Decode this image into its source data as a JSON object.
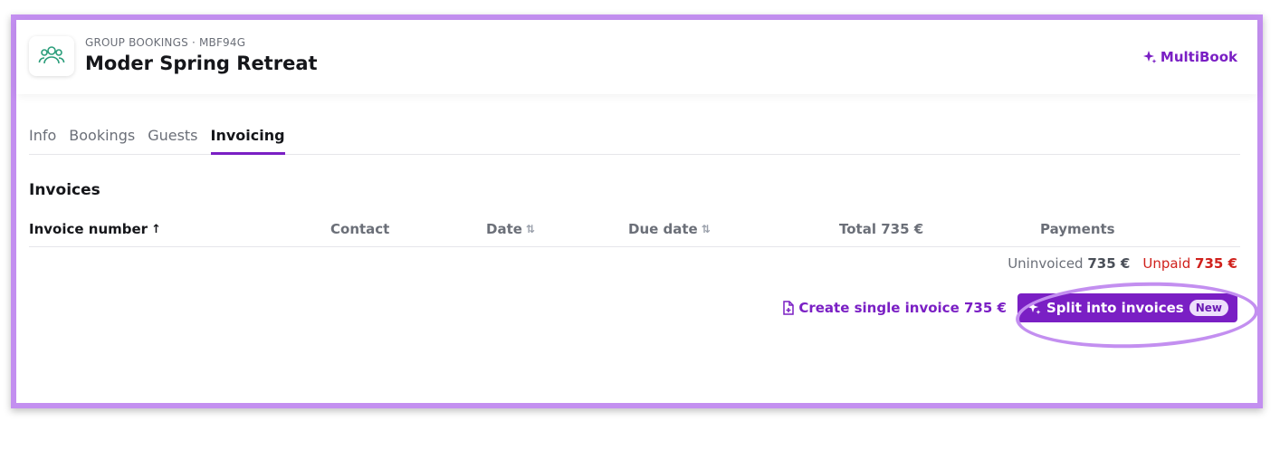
{
  "header": {
    "eyebrow": "GROUP BOOKINGS · MBF94G",
    "title": "Moder Spring Retreat",
    "brand_label": "MultiBook",
    "logo_icon": "group-people-icon",
    "brand_icon": "sparkle-icon"
  },
  "tabs": [
    {
      "label": "Info",
      "active": false
    },
    {
      "label": "Bookings",
      "active": false
    },
    {
      "label": "Guests",
      "active": false
    },
    {
      "label": "Invoicing",
      "active": true
    }
  ],
  "invoices": {
    "section_title": "Invoices",
    "columns": [
      {
        "label": "Invoice number",
        "sort": "asc"
      },
      {
        "label": "Contact",
        "sort": "none"
      },
      {
        "label": "Date",
        "sort": "sortable"
      },
      {
        "label": "Due date",
        "sort": "sortable"
      },
      {
        "label": "Total 735 €",
        "sort": "none"
      },
      {
        "label": "Payments",
        "sort": "none"
      }
    ],
    "rows": [],
    "summary": {
      "uninvoiced_label": "Uninvoiced",
      "uninvoiced_value": "735 €",
      "unpaid_label": "Unpaid",
      "unpaid_value": "735 €"
    },
    "actions": {
      "create_single_label": "Create single invoice 735 €",
      "split_label": "Split into invoices",
      "split_badge": "New"
    }
  },
  "colors": {
    "accent": "#7a1fc4",
    "highlight": "#c38ff0",
    "unpaid": "#d0211c",
    "logo": "#2a9d7a"
  }
}
